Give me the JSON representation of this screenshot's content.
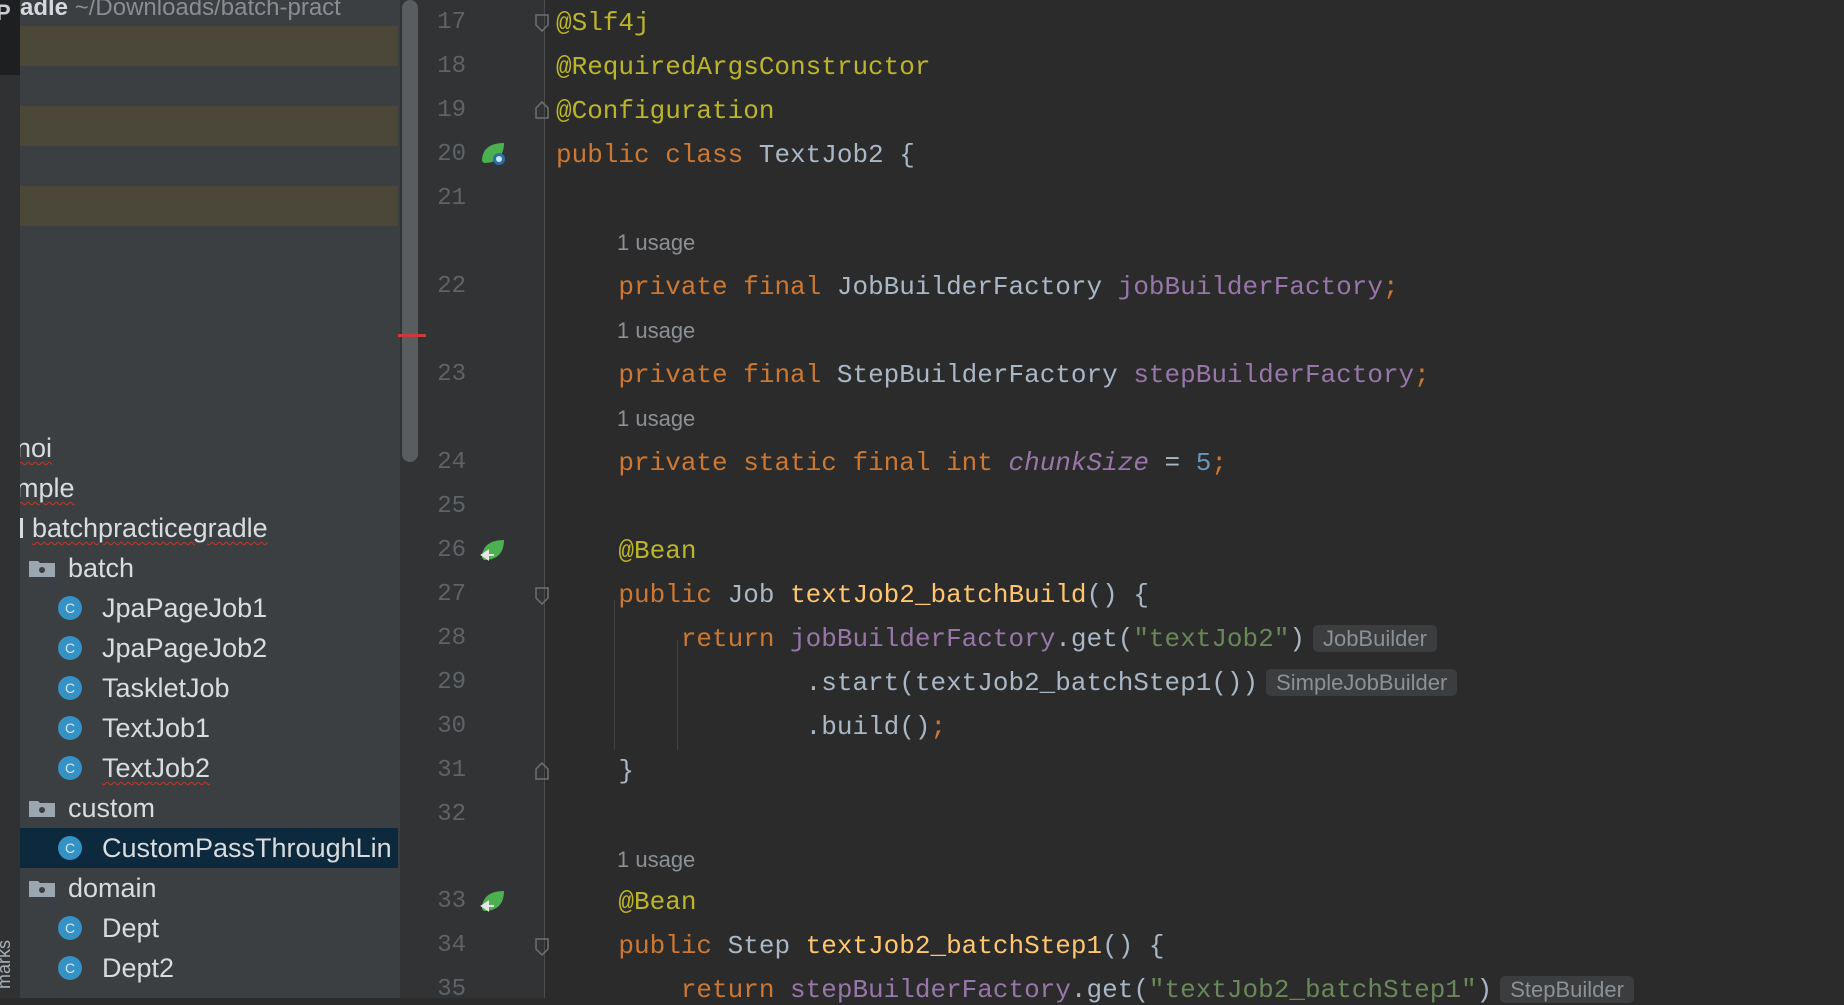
{
  "project_panel": {
    "header_name": "adle",
    "header_path": "~/Downloads/batch-pract",
    "tree": [
      {
        "label": "noi",
        "kind": "package",
        "squiggle": true
      },
      {
        "label": "mple",
        "kind": "package",
        "squiggle": true
      },
      {
        "label": "batchpracticegradle",
        "kind": "package",
        "squiggle": true
      },
      {
        "label": "batch",
        "kind": "folder"
      },
      {
        "label": "JpaPageJob1",
        "kind": "class"
      },
      {
        "label": "JpaPageJob2",
        "kind": "class"
      },
      {
        "label": "TaskletJob",
        "kind": "class"
      },
      {
        "label": "TextJob1",
        "kind": "class"
      },
      {
        "label": "TextJob2",
        "kind": "class",
        "squiggle": true
      },
      {
        "label": "custom",
        "kind": "folder"
      },
      {
        "label": "CustomPassThroughLin",
        "kind": "class",
        "selected": true
      },
      {
        "label": "domain",
        "kind": "folder"
      },
      {
        "label": "Dept",
        "kind": "class"
      },
      {
        "label": "Dept2",
        "kind": "class"
      }
    ],
    "side_label": "marks"
  },
  "editor": {
    "line_numbers": [
      "17",
      "18",
      "19",
      "20",
      "21",
      "22",
      "23",
      "24",
      "25",
      "26",
      "27",
      "28",
      "29",
      "30",
      "31",
      "32",
      "33",
      "34",
      "35"
    ],
    "usage_hint": "1 usage",
    "lines": {
      "l17": "@Slf4j",
      "l18": "@RequiredArgsConstructor",
      "l19": "@Configuration",
      "l20_kw": "public class ",
      "l20_name": "TextJob2 {",
      "l22_kw": "private final ",
      "l22_type": "JobBuilderFactory ",
      "l22_field": "jobBuilderFactory",
      "l22_semi": ";",
      "l23_kw": "private final ",
      "l23_type": "StepBuilderFactory ",
      "l23_field": "stepBuilderFactory",
      "l23_semi": ";",
      "l24_kw": "private static final int ",
      "l24_field": "chunkSize",
      "l24_eq": " = ",
      "l24_num": "5",
      "l24_semi": ";",
      "l26": "@Bean",
      "l27_kw": "public ",
      "l27_type": "Job ",
      "l27_fn": "textJob2_batchBuild",
      "l27_rest": "() {",
      "l28_kw": "return ",
      "l28_field": "jobBuilderFactory",
      "l28_call": ".get(",
      "l28_str": "\"textJob2\"",
      "l28_close": ")",
      "l28_hint": "JobBuilder",
      "l29": ".start(textJob2_batchStep1())",
      "l29_hint": "SimpleJobBuilder",
      "l30": ".build()",
      "l30_semi": ";",
      "l31": "}",
      "l33": "@Bean",
      "l34_kw": "public ",
      "l34_type": "Step ",
      "l34_fn": "textJob2_batchStep1",
      "l34_rest": "() {",
      "l35_kw": "return ",
      "l35_field": "stepBuilderFactory",
      "l35_call": ".get(",
      "l35_str": "\"textJob2_batchStep1\"",
      "l35_close": ")",
      "l35_hint": "StepBuilder"
    }
  },
  "colors": {
    "background": "#2b2b2b",
    "keyword": "#cc7832",
    "annotation": "#bbb529",
    "field": "#9876aa",
    "method": "#ffc66d",
    "number": "#6897bb",
    "string": "#6a8759",
    "selection": "#0d293e",
    "class_icon": "#3592c4",
    "spring_icon": "#4caf50"
  },
  "icons": {
    "gutter_class": "spring-bean-class-icon",
    "gutter_bean": "spring-bean-method-icon",
    "tree_folder": "package-folder-icon",
    "tree_class": "java-class-icon"
  }
}
